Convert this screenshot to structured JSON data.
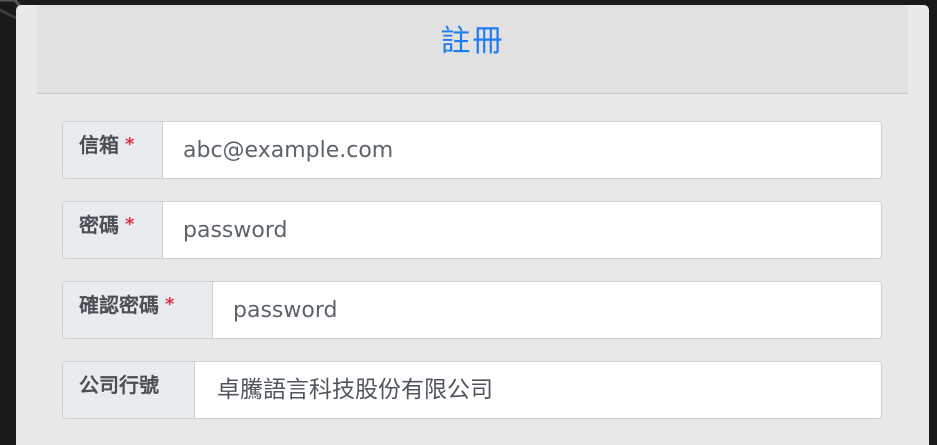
{
  "header": {
    "title": "註冊"
  },
  "form": {
    "email": {
      "label": "信箱",
      "required_mark": "*",
      "placeholder": "abc@example.com"
    },
    "password": {
      "label": "密碼",
      "required_mark": "*",
      "placeholder": "password"
    },
    "confirm_password": {
      "label": "確認密碼",
      "required_mark": "*",
      "placeholder": "password"
    },
    "company": {
      "label": "公司行號",
      "value": "卓騰語言科技股份有限公司"
    }
  },
  "colors": {
    "title": "#1e7bf0",
    "required": "#dc3545",
    "label_bg": "#e9ecef"
  }
}
